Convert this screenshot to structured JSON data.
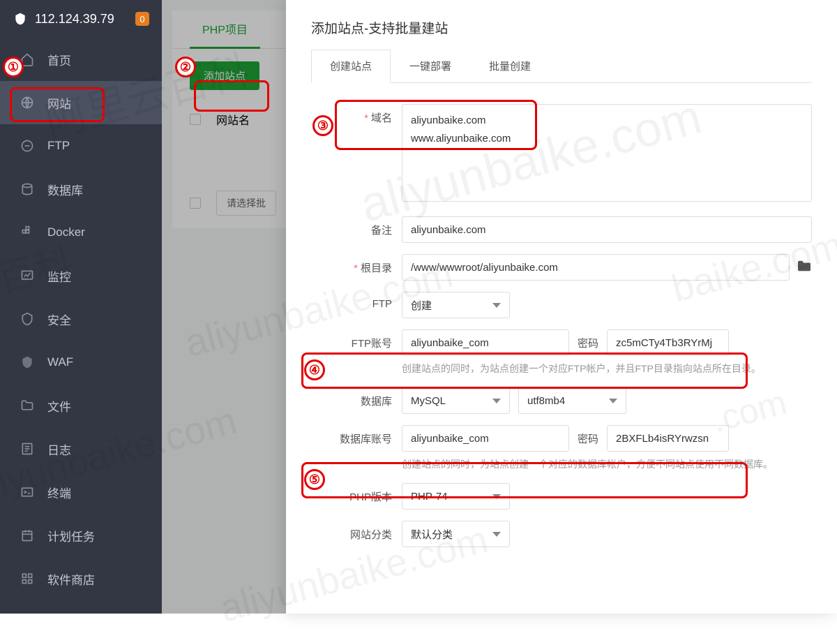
{
  "sidebar": {
    "ip": "112.124.39.79",
    "badge": "0",
    "items": [
      {
        "label": "首页"
      },
      {
        "label": "网站"
      },
      {
        "label": "FTP"
      },
      {
        "label": "数据库"
      },
      {
        "label": "Docker"
      },
      {
        "label": "监控"
      },
      {
        "label": "安全"
      },
      {
        "label": "WAF"
      },
      {
        "label": "文件"
      },
      {
        "label": "日志"
      },
      {
        "label": "终端"
      },
      {
        "label": "计划任务"
      },
      {
        "label": "软件商店"
      }
    ]
  },
  "content": {
    "tab": "PHP项目",
    "add_btn": "添加站点",
    "col_name": "网站名",
    "select_batch": "请选择批"
  },
  "modal": {
    "title": "添加站点-支持批量建站",
    "tabs": [
      "创建站点",
      "一键部署",
      "批量创建"
    ],
    "labels": {
      "domain": "域名",
      "remark": "备注",
      "root": "根目录",
      "ftp": "FTP",
      "ftp_account": "FTP账号",
      "password": "密码",
      "database": "数据库",
      "db_account": "数据库账号",
      "php_version": "PHP版本",
      "site_category": "网站分类"
    },
    "values": {
      "domain": "aliyunbaike.com\nwww.aliyunbaike.com",
      "remark": "aliyunbaike.com",
      "root": "/www/wwwroot/aliyunbaike.com",
      "ftp_select": "创建",
      "ftp_account": "aliyunbaike_com",
      "ftp_password": "zc5mCTy4Tb3RYrMj",
      "db_select": "MySQL",
      "db_charset": "utf8mb4",
      "db_account": "aliyunbaike_com",
      "db_password": "2BXFLb4isRYrwzsn",
      "php_version": "PHP-74",
      "site_category": "默认分类"
    },
    "hints": {
      "ftp": "创建站点的同时，为站点创建一个对应FTP帐户，并且FTP目录指向站点所在目录。",
      "db": "创建站点的同时，为站点创建一个对应的数据库帐户，方便不同站点使用不同数据库。"
    }
  },
  "markers": [
    "①",
    "②",
    "③",
    "④",
    "⑤"
  ],
  "watermark_cn": "阿里云百科",
  "watermark_en": "aliyunbaike.com"
}
